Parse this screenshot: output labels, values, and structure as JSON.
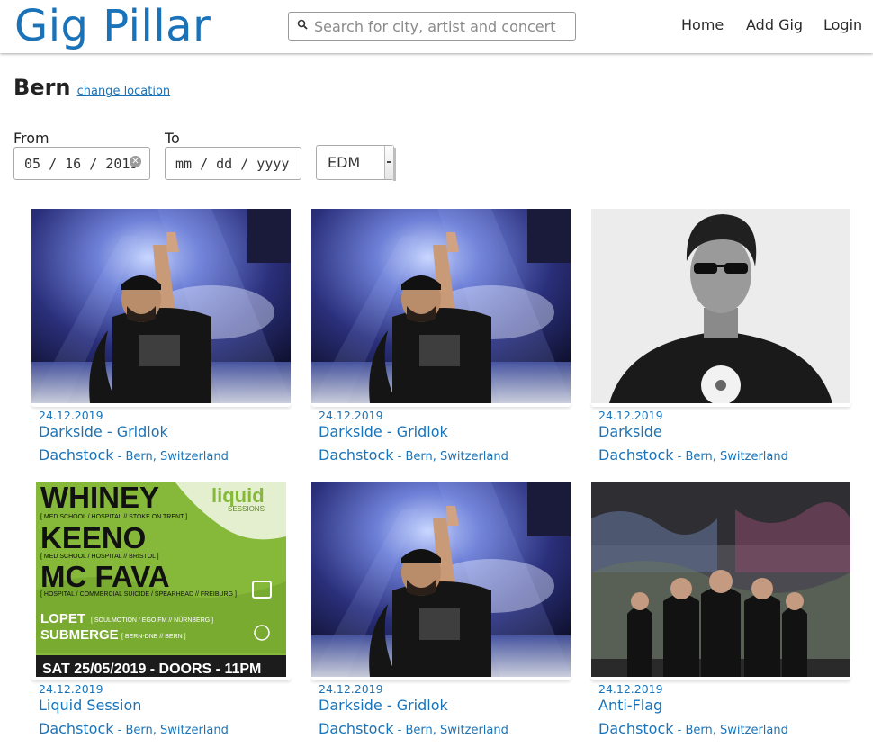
{
  "header": {
    "brand": "Gig Pillar",
    "search_placeholder": "Search for city, artist and concert",
    "nav": {
      "home": "Home",
      "add_gig": "Add Gig",
      "login": "Login"
    }
  },
  "location": {
    "city": "Bern",
    "change_label": "change location"
  },
  "filters": {
    "from_label": "From",
    "to_label": "To",
    "from_value": "05 / 16 / 2019",
    "to_placeholder": "mm / dd / yyyy",
    "genre_selected": "EDM"
  },
  "gigs": [
    {
      "date": "24.12.2019",
      "title": "Darkside - Gridlok",
      "venue": "Dachstock",
      "place": " - Bern, Switzerland",
      "image": "dj-stage-photo"
    },
    {
      "date": "24.12.2019",
      "title": "Darkside - Gridlok",
      "venue": "Dachstock",
      "place": " - Bern, Switzerland",
      "image": "dj-stage-photo"
    },
    {
      "date": "24.12.2019",
      "title": "Darkside",
      "venue": "Dachstock",
      "place": " - Bern, Switzerland",
      "image": "portrait-photo"
    },
    {
      "date": "24.12.2019",
      "title": "Liquid Session",
      "venue": "Dachstock",
      "place": " - Bern, Switzerland",
      "image": "event-poster",
      "poster": {
        "line1": "WHINEY",
        "line1_sub": "[ MED SCHOOL / HOSPITAL // STOKE ON TRENT ]",
        "line2": "KEENO",
        "line2_sub": "[ MED SCHOOL / HOSPITAL // BRISTOL ]",
        "line3": "MC FAVA",
        "line3_sub": "[ HOSPITAL / COMMERCIAL SUICIDE / SPEARHEAD // FREIBURG ]",
        "line4": "LOPET",
        "line4_sub": "[ SOULMOTION / EGO.FM // NÜRNBERG ]",
        "line5": "SUBMERGE",
        "line5_sub": "[ BERN-DNB // BERN ]",
        "logo": "liquid",
        "logo_sub": "SESSIONS",
        "footer": "SAT 25/05/2019 - DOORS - 11PM"
      }
    },
    {
      "date": "24.12.2019",
      "title": "Darkside - Gridlok",
      "venue": "Dachstock",
      "place": " - Bern, Switzerland",
      "image": "dj-stage-photo"
    },
    {
      "date": "24.12.2019",
      "title": "Anti-Flag",
      "venue": "Dachstock",
      "place": " - Bern, Switzerland",
      "image": "band-photo"
    }
  ],
  "colors": {
    "link": "#1a73b8",
    "poster_green": "#7fb82f"
  }
}
